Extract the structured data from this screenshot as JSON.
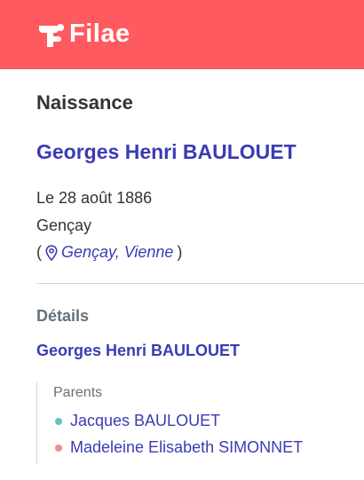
{
  "brand": {
    "name": "Filae",
    "color": "#ff5a5f"
  },
  "event": {
    "title": "Naissance",
    "person_name": "Georges Henri BAULOUET",
    "date": "Le 28 août 1886",
    "city": "Gençay",
    "location_open": "(",
    "location_icon": "map-pin-icon",
    "location_link": "Gençay, Vienne",
    "location_close": ")"
  },
  "details": {
    "title": "Détails",
    "person_name": "Georges Henri BAULOUET",
    "parents_label": "Parents",
    "parents": [
      {
        "name": "Jacques BAULOUET",
        "dot_color": "#5bc4c0"
      },
      {
        "name": "Madeleine Elisabeth SIMONNET",
        "dot_color": "#f28b8b"
      }
    ]
  },
  "colors": {
    "link": "#3b3bb5",
    "muted_heading": "#66707a"
  }
}
